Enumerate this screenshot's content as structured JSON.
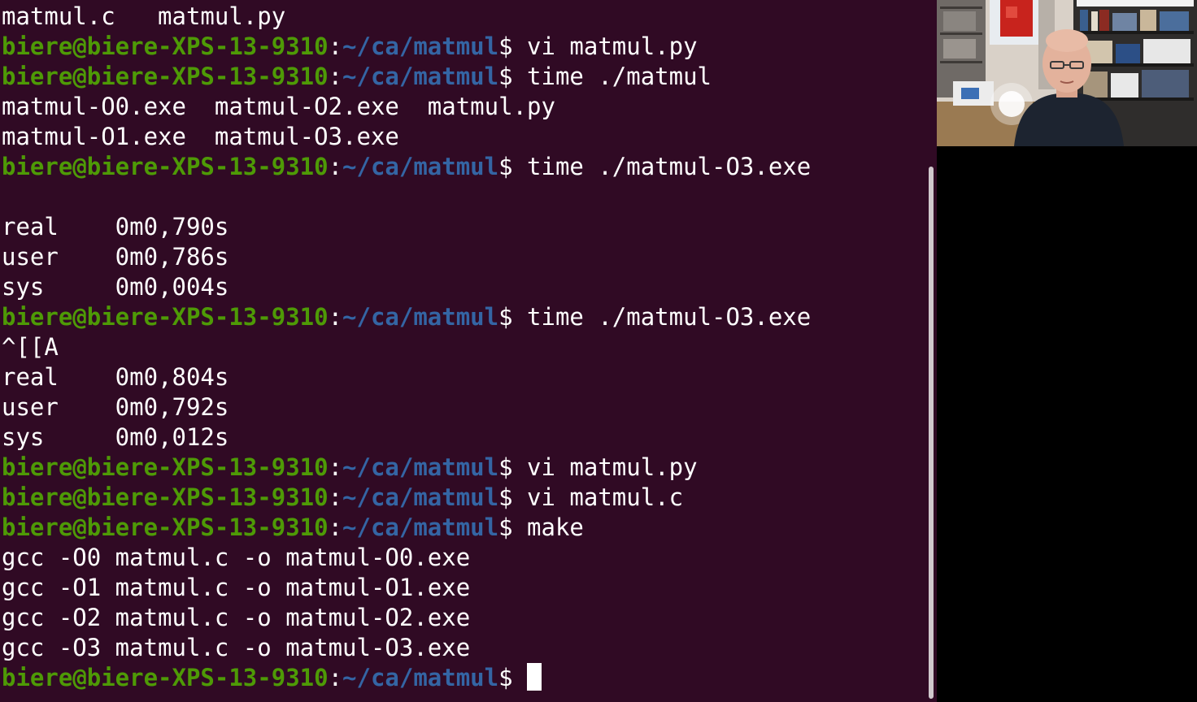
{
  "terminal": {
    "prompt": {
      "user_host": "biere@biere-XPS-13-9310",
      "colon": ":",
      "path": "~/ca/matmul",
      "dollar": "$"
    },
    "lines": [
      {
        "kind": "output",
        "text": "matmul.c   matmul.py"
      },
      {
        "kind": "prompt",
        "cmd": " vi matmul.py"
      },
      {
        "kind": "prompt",
        "cmd": " time ./matmul"
      },
      {
        "kind": "output",
        "text": "matmul-O0.exe  matmul-O2.exe  matmul.py"
      },
      {
        "kind": "output",
        "text": "matmul-O1.exe  matmul-O3.exe"
      },
      {
        "kind": "prompt",
        "cmd": " time ./matmul-O3.exe"
      },
      {
        "kind": "output",
        "text": ""
      },
      {
        "kind": "output",
        "text": "real\t0m0,790s"
      },
      {
        "kind": "output",
        "text": "user\t0m0,786s"
      },
      {
        "kind": "output",
        "text": "sys\t0m0,004s"
      },
      {
        "kind": "prompt",
        "cmd": " time ./matmul-O3.exe"
      },
      {
        "kind": "output",
        "text": "^[[A"
      },
      {
        "kind": "output",
        "text": "real\t0m0,804s"
      },
      {
        "kind": "output",
        "text": "user\t0m0,792s"
      },
      {
        "kind": "output",
        "text": "sys\t0m0,012s"
      },
      {
        "kind": "prompt",
        "cmd": " vi matmul.py"
      },
      {
        "kind": "prompt",
        "cmd": " vi matmul.c"
      },
      {
        "kind": "prompt",
        "cmd": " make"
      },
      {
        "kind": "output",
        "text": "gcc -O0 matmul.c -o matmul-O0.exe"
      },
      {
        "kind": "output",
        "text": "gcc -O1 matmul.c -o matmul-O1.exe"
      },
      {
        "kind": "output",
        "text": "gcc -O2 matmul.c -o matmul-O2.exe"
      },
      {
        "kind": "output",
        "text": "gcc -O3 matmul.c -o matmul-O3.exe"
      },
      {
        "kind": "prompt",
        "cmd": " ",
        "cursor": true
      }
    ]
  },
  "colors": {
    "terminal_bg": "#300a24",
    "prompt_user": "#4e9a06",
    "prompt_path": "#3465a4",
    "text": "#ffffff"
  }
}
